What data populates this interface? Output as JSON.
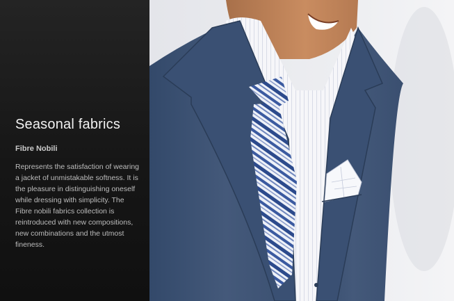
{
  "panel": {
    "title": "Seasonal fabrics",
    "subtitle": "Fibre Nobili",
    "body": "Represents the satisfaction of wearing a jacket of unmistakable softness. It is the pleasure in distinguishing oneself while dressing with simplicity. The Fibre nobili fabrics collection is reintroduced with new compositions, new combinations and the utmost fineness."
  },
  "colors": {
    "panel_background": "#1a1a1a",
    "title_text": "#f2f2f2",
    "body_text": "#bdbdbd",
    "photo_background": "#ecedf1",
    "suit_blue": "#3c5372",
    "tie_stripe": "#2c4a8c"
  }
}
